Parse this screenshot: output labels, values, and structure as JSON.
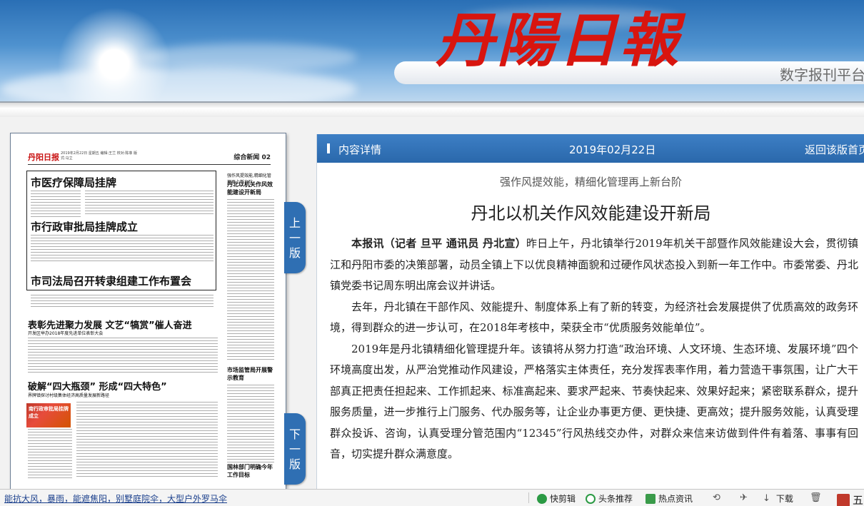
{
  "header": {
    "logo": "丹陽日報",
    "platform_label": "数字报刊平台"
  },
  "newspaper": {
    "masthead": "丹阳日报",
    "date_line": "2019年2月22日 星期五 编辑:王兰 校对:陈菲 版式:马立",
    "section": "综合新闻 02",
    "headlines": {
      "h1": "市医疗保障局挂牌",
      "h2": "市行政审批局挂牌成立",
      "h3": "市司法局召开转隶组建工作布置会",
      "h4": "表彰先进聚力发展 文艺“犒赏”催人奋进",
      "h4_sub": "开发区举办2018年度先进单位表彰大会",
      "h5": "破解“四大瓶颈” 形成“四大特色”",
      "h5_sub": "界牌镇探讨村级集体经济高质量发展新路径",
      "side1": "丹北以机关作风效能建设开新局",
      "side1_pre": "强作风提效能,精细化管理再上新台阶",
      "side2": "市场监管局开展警示教育",
      "side3": "国林部门明确今年工作目标",
      "photo_text": "南行政审批局挂牌成立"
    }
  },
  "nav": {
    "prev_page": [
      "上",
      "一",
      "版"
    ],
    "next_page": [
      "下",
      "一",
      "版"
    ]
  },
  "panel": {
    "bar_title": "内容详情",
    "date": "2019年02月22日",
    "back_label": "返回该版首页",
    "subtitle": "强作风提效能，精细化管理再上新台阶",
    "title": "丹北以机关作风效能建设开新局",
    "lead_bold": "本报讯（记者 旦平 通讯员 丹北宣）",
    "p1": "昨日上午，丹北镇举行2019年机关干部暨作风效能建设大会，贯彻镇江和丹阳市委的决策部署，动员全镇上下以优良精神面貌和过硬作风状态投入到新一年工作中。市委常委、丹北镇党委书记周东明出席会议并讲话。",
    "p2": "去年，丹北镇在干部作风、效能提升、制度体系上有了新的转变，为经济社会发展提供了优质高效的政务环境，得到群众的进一步认可，在2018年考核中，荣获全市“优质服务效能单位”。",
    "p3": "2019年是丹北镇精细化管理提升年。该镇将从努力打造“政治环境、人文环境、生态环境、发展环境”四个环境高度出发，从严治党推动作风建设，严格落实主体责任，充分发挥表率作用，着力营造干事氛围，让广大干部真正把责任担起来、工作抓起来、标准高起来、要求严起来、节奏快起来、效果好起来；紧密联系群众，提升服务质量，进一步推行上门服务、代办服务等，让企业办事更方便、更快捷、更高效；提升服务效能，认真受理群众投诉、咨询，认真受理分管范围内“12345”行风热线交办件，对群众来信来访做到件件有着落、事事有回音，切实提升群众满意度。"
  },
  "statusbar": {
    "ticker": "能抗大风，暴雨，能遮焦阳，别墅庭院伞，大型户外罗马伞",
    "tools": {
      "quick_edit": "快剪辑",
      "headline": "头条推荐",
      "hot_news": "热点资讯",
      "download": "下载",
      "five": "五"
    }
  }
}
